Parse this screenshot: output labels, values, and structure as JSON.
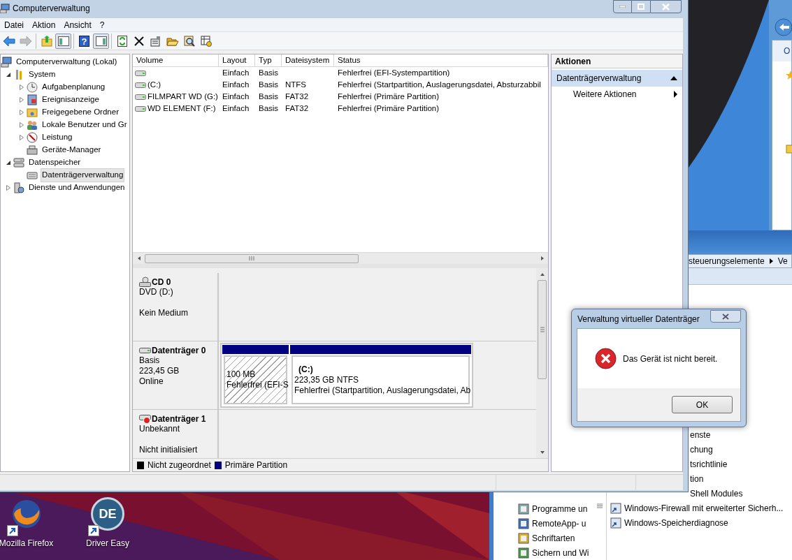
{
  "main_window": {
    "title": "Computerverwaltung",
    "menu": [
      "Datei",
      "Aktion",
      "Ansicht",
      "?"
    ],
    "toolbar_groups": [
      {
        "buttons": [
          {
            "kind": "back",
            "disabled": false,
            "pressed": false
          },
          {
            "kind": "forward",
            "disabled": true,
            "pressed": false
          }
        ]
      },
      {
        "buttons": [
          {
            "kind": "up",
            "disabled": false,
            "pressed": false
          },
          {
            "kind": "tree_toggle",
            "disabled": false,
            "pressed": true
          }
        ]
      },
      {
        "buttons": [
          {
            "kind": "help",
            "label": "?",
            "disabled": false,
            "pressed": false
          },
          {
            "kind": "action_toggle",
            "disabled": false,
            "pressed": true
          }
        ]
      },
      {
        "buttons": [
          {
            "kind": "refresh",
            "disabled": false,
            "pressed": false
          },
          {
            "kind": "delete",
            "disabled": false,
            "pressed": false
          },
          {
            "kind": "properties",
            "disabled": false,
            "pressed": false
          },
          {
            "kind": "open",
            "disabled": false,
            "pressed": false
          },
          {
            "kind": "search",
            "disabled": false,
            "pressed": false
          },
          {
            "kind": "settings",
            "disabled": false,
            "pressed": false
          }
        ]
      }
    ],
    "tree": [
      {
        "label": "Computerverwaltung (Lokal)",
        "selected": false,
        "children": [
          {
            "label": "System",
            "expandable": true,
            "expanded": true,
            "selected": false,
            "children": [
              {
                "label": "Aufgabenplanung",
                "expandable": true,
                "expanded": false,
                "selected": false
              },
              {
                "label": "Ereignisanzeige",
                "expandable": true,
                "expanded": false,
                "selected": false
              },
              {
                "label": "Freigegebene Ordner",
                "expandable": true,
                "expanded": false,
                "selected": false
              },
              {
                "label": "Lokale Benutzer und Gr",
                "expandable": true,
                "expanded": false,
                "selected": false
              },
              {
                "label": "Leistung",
                "expandable": true,
                "expanded": false,
                "selected": false
              },
              {
                "label": "Geräte-Manager",
                "expandable": false,
                "expanded": false,
                "selected": false
              }
            ]
          },
          {
            "label": "Datenspeicher",
            "expandable": true,
            "expanded": true,
            "selected": false,
            "children": [
              {
                "label": "Datenträgerverwaltung",
                "expandable": false,
                "expanded": false,
                "selected": true
              }
            ]
          },
          {
            "label": "Dienste und Anwendungen",
            "expandable": true,
            "expanded": false,
            "selected": false
          }
        ]
      }
    ],
    "volume_table": {
      "columns": [
        "Volume",
        "Layout",
        "Typ",
        "Dateisystem",
        "Status"
      ],
      "rows": [
        {
          "layout": "Einfach",
          "type": "Basis",
          "status": "Fehlerfrei (EFI-Systempartition)"
        },
        {
          "volume": "(C:)",
          "layout": "Einfach",
          "type": "Basis",
          "filesystem": "NTFS",
          "status": "Fehlerfrei (Startpartition, Auslagerungsdatei, Absturzabbil"
        },
        {
          "volume": "FILMPART WD (G:)",
          "layout": "Einfach",
          "type": "Basis",
          "filesystem": "FAT32",
          "status": "Fehlerfrei (Primäre Partition)"
        },
        {
          "volume": "WD ELEMENT (F:)",
          "layout": "Einfach",
          "type": "Basis",
          "filesystem": "FAT32",
          "status": "Fehlerfrei (Primäre Partition)"
        }
      ]
    },
    "disks": [
      {
        "kind": "cd",
        "name": "CD 0",
        "details": [
          "DVD (D:)"
        ],
        "status": "Kein Medium"
      },
      {
        "kind": "basic",
        "name": "Datenträger 0",
        "details": [
          "Basis",
          "223,45 GB",
          "Online"
        ],
        "partitions": [
          {
            "hatched": true,
            "size": "100 MB",
            "status": "Fehlerfrei (EFI-S"
          },
          {
            "hatched": false,
            "label": "(C:)",
            "size": "223,35 GB NTFS",
            "status": "Fehlerfrei (Startpartition, Auslagerungsdatei, Ab"
          }
        ]
      },
      {
        "kind": "unknown",
        "name": "Datenträger 1",
        "details": [
          "Unbekannt"
        ],
        "status": "Nicht initialisiert"
      }
    ],
    "legend": [
      {
        "label": "Nicht zugeordnet",
        "color": "#000000"
      },
      {
        "label": "Primäre Partition",
        "color": "#000080"
      }
    ],
    "actions": {
      "title": "Aktionen",
      "section": "Datenträgerverwaltung",
      "items": [
        "Weitere Aktionen"
      ]
    }
  },
  "dialog": {
    "title": "Verwaltung virtueller Datenträger",
    "message": "Das Gerät ist nicht bereit.",
    "button": "OK"
  },
  "background_window": {
    "tab": "O",
    "breadcrumb": [
      "steuerungselemente",
      "Ve"
    ],
    "nav_items": [
      "Programme un",
      "RemoteApp- u",
      "Schriftarten",
      "Sichern und Wi"
    ],
    "items": [
      {
        "label": "enste",
        "cut": true
      },
      {
        "label": "chung",
        "cut": true
      },
      {
        "label": "tsrichtlinie",
        "cut": true
      },
      {
        "label": "tion",
        "cut": true
      },
      {
        "label": "Shell Modules",
        "cut": true
      },
      {
        "label": "Windows-Firewall mit erweiterter Sicherh...",
        "cut": false
      },
      {
        "label": "Windows-Speicherdiagnose",
        "cut": false
      }
    ]
  },
  "desktop_icons": [
    {
      "kind": "firefox",
      "label": "Mozilla Firefox"
    },
    {
      "kind": "drivereasy",
      "label": "Driver Easy",
      "logo_text": "DE"
    }
  ]
}
